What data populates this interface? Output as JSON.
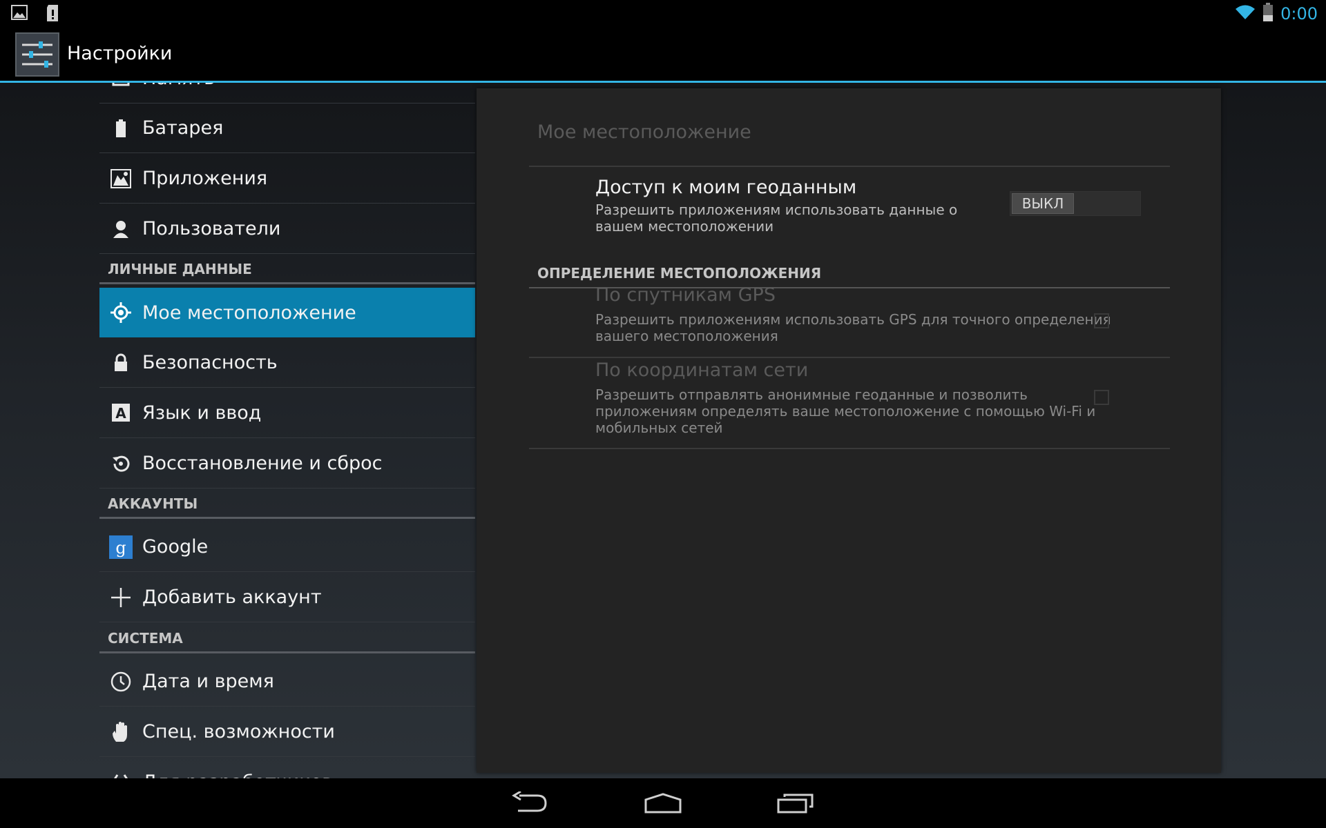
{
  "status_bar": {
    "time": "0:00",
    "notification_icons": [
      "image-icon",
      "sd-card-icon"
    ],
    "status_icons": [
      "wifi-icon",
      "battery-icon"
    ]
  },
  "action_bar": {
    "title": "Настройки",
    "icon": "settings-sliders-icon"
  },
  "sidebar": {
    "items": [
      {
        "label": "Память",
        "icon": "storage-icon"
      },
      {
        "label": "Батарея",
        "icon": "battery-icon"
      },
      {
        "label": "Приложения",
        "icon": "apps-icon"
      },
      {
        "label": "Пользователи",
        "icon": "users-icon"
      },
      {
        "label": "Мое местоположение",
        "icon": "location-icon",
        "selected": true
      },
      {
        "label": "Безопасность",
        "icon": "lock-icon"
      },
      {
        "label": "Язык и ввод",
        "icon": "language-icon"
      },
      {
        "label": "Восстановление и сброс",
        "icon": "restore-icon"
      },
      {
        "label": "Google",
        "icon": "google-icon"
      },
      {
        "label": "Добавить аккаунт",
        "icon": "add-icon"
      },
      {
        "label": "Дата и время",
        "icon": "clock-icon"
      },
      {
        "label": "Спец. возможности",
        "icon": "hand-icon"
      },
      {
        "label": "Для разработчиков",
        "icon": "developer-icon"
      }
    ],
    "headers": {
      "personal": "ЛИЧНЫЕ ДАННЫЕ",
      "accounts": "АККАУНТЫ",
      "system": "СИСТЕМА"
    }
  },
  "detail": {
    "title": "Мое местоположение",
    "access": {
      "title": "Доступ к моим геоданным",
      "summary_line1": "Разрешить приложениям использовать данные о",
      "summary_line2": "вашем местоположении",
      "toggle_label": "ВЫКЛ",
      "toggle_on": false
    },
    "category": "ОПРЕДЕЛЕНИЕ МЕСТОПОЛОЖЕНИЯ",
    "gps": {
      "title": "По спутникам GPS",
      "summary_line1": "Разрешить приложениям использовать GPS для точного определения",
      "summary_line2": "вашего местоположения",
      "checked": false,
      "enabled": false
    },
    "network": {
      "title": "По координатам сети",
      "summary_line1": "Разрешить отправлять анонимные геоданные и позволить",
      "summary_line2": "приложениям определять ваше местоположение с помощью Wi-Fi и",
      "summary_line3": "мобильных сетей",
      "checked": false,
      "enabled": false
    }
  },
  "navigation": {
    "buttons": [
      "back-icon",
      "home-icon",
      "recent-apps-icon"
    ]
  },
  "colors": {
    "accent": "#33b5e5",
    "selected": "#0a80ad",
    "panel": "#232323"
  }
}
